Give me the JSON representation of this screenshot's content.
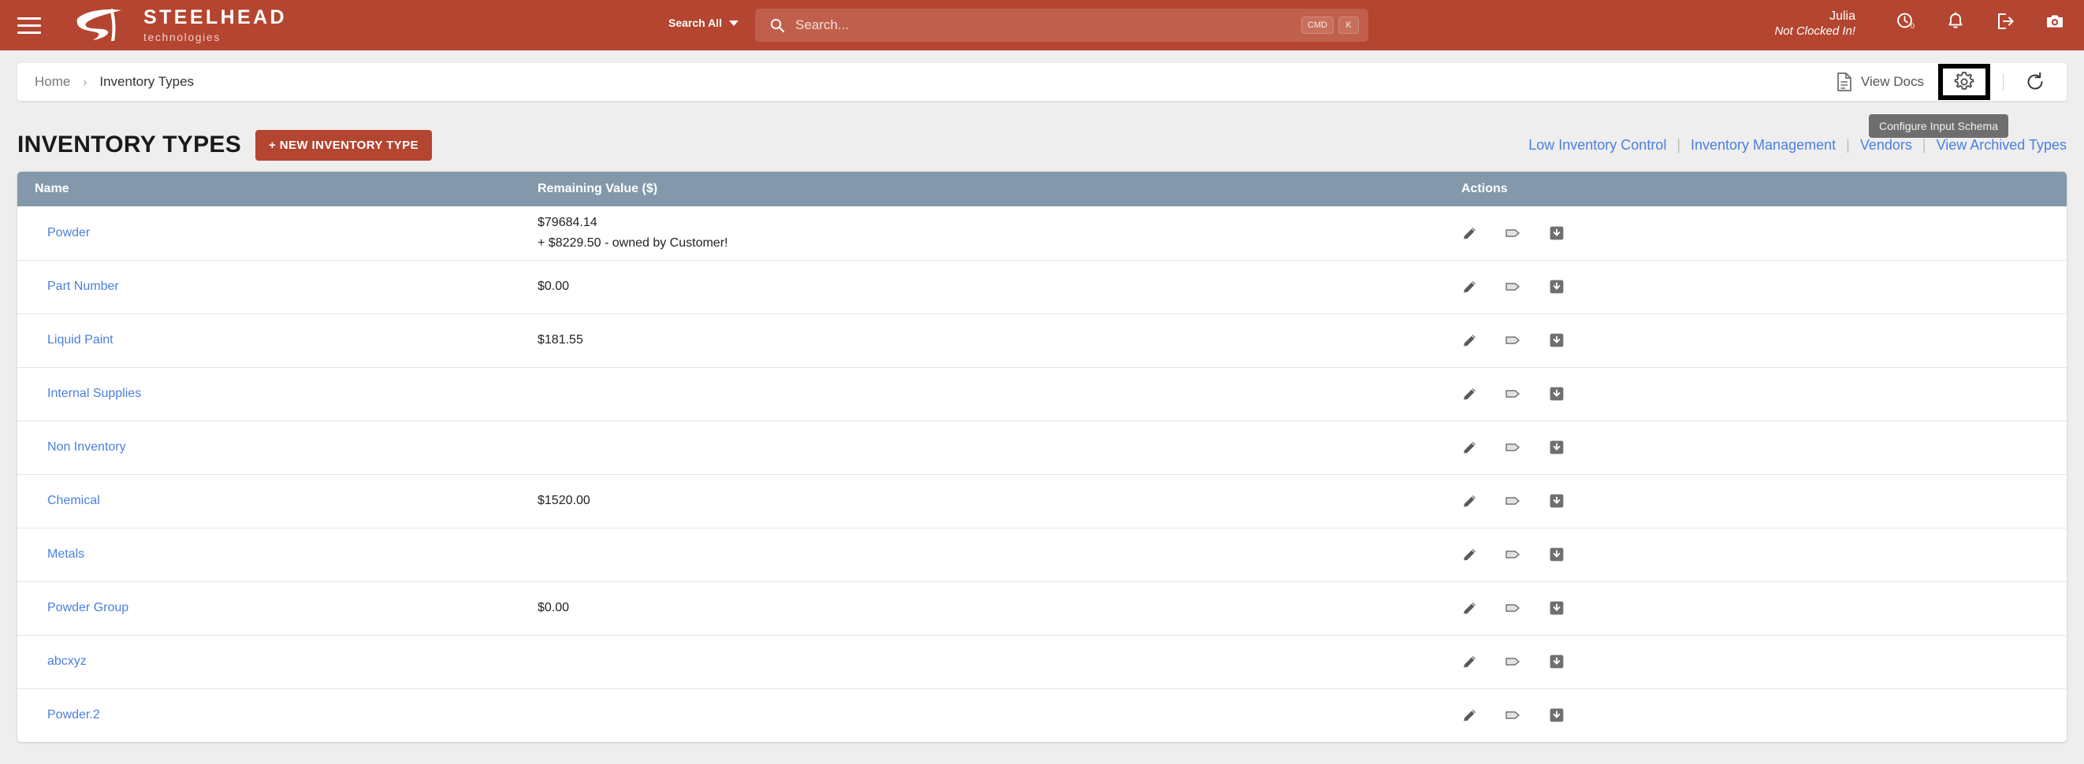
{
  "header": {
    "menu_icon": "hamburger-icon",
    "brand_name": "STEELHEAD",
    "brand_sub": "technologies",
    "search_scope_label": "Search All",
    "search_placeholder": "Search...",
    "search_value": "",
    "kbd_modifier": "CMD",
    "kbd_key": "K",
    "user_name": "Julia",
    "user_status": "Not Clocked In!",
    "clock_badge": "0",
    "icons": [
      "clock-icon",
      "bell-icon",
      "logout-icon",
      "camera-icon"
    ],
    "accent_color": "#b44530"
  },
  "breadcrumb": {
    "home_label": "Home",
    "separator": "›",
    "current_label": "Inventory Types",
    "view_docs_label": "View Docs",
    "gear_tooltip": "Configure Input Schema",
    "gear_highlighted": true
  },
  "title_row": {
    "page_title": "INVENTORY TYPES",
    "new_button_label": "+ NEW INVENTORY TYPE",
    "quick_links": [
      "Low Inventory Control",
      "Inventory Management",
      "Vendors",
      "View Archived Types"
    ],
    "link_color": "#4a7fe0"
  },
  "table": {
    "header_bg": "#8399ab",
    "columns": [
      "Name",
      "Remaining Value ($)",
      "Actions"
    ],
    "action_icons": [
      "pencil-icon",
      "tag-icon",
      "archive-icon"
    ],
    "rows": [
      {
        "name": "Powder",
        "value": "$79684.14",
        "value_sub": "+ $8229.50 - owned by Customer!"
      },
      {
        "name": "Part Number",
        "value": "$0.00",
        "value_sub": ""
      },
      {
        "name": "Liquid Paint",
        "value": "$181.55",
        "value_sub": ""
      },
      {
        "name": "Internal Supplies",
        "value": "",
        "value_sub": ""
      },
      {
        "name": "Non Inventory",
        "value": "",
        "value_sub": ""
      },
      {
        "name": "Chemical",
        "value": "$1520.00",
        "value_sub": ""
      },
      {
        "name": "Metals",
        "value": "",
        "value_sub": ""
      },
      {
        "name": "Powder Group",
        "value": "$0.00",
        "value_sub": ""
      },
      {
        "name": "abcxyz",
        "value": "",
        "value_sub": ""
      },
      {
        "name": "Powder.2",
        "value": "",
        "value_sub": ""
      }
    ]
  }
}
